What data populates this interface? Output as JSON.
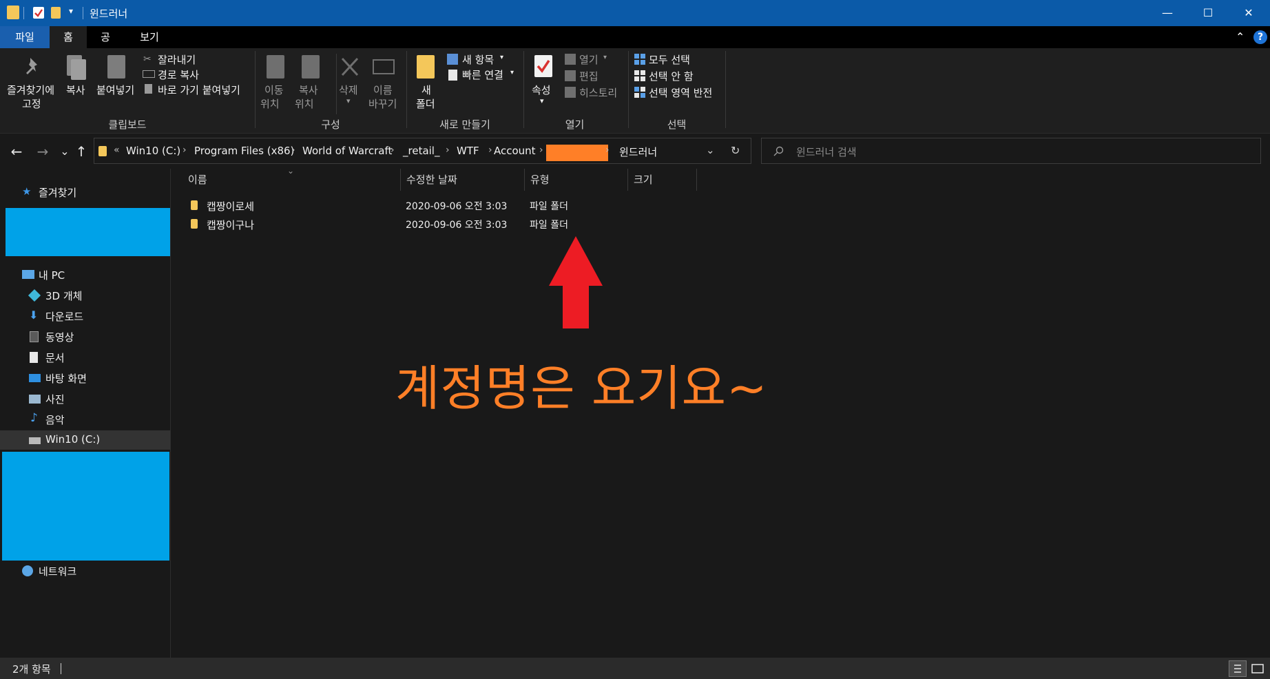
{
  "window": {
    "title": "윈드러너",
    "minimize": "—",
    "maximize": "☐",
    "close": "✕",
    "qat_dropdown": "▾"
  },
  "ribbon_tabs": [
    "파일",
    "홈",
    "공유",
    "보기"
  ],
  "ribbon_help": "?",
  "ribbon_collapse": "⌃",
  "ribbon": {
    "clipboard": {
      "title": "클립보드",
      "pin_line1": "즐겨찾기에",
      "pin_line2": "고정",
      "copy": "복사",
      "paste": "붙여넣기",
      "cut": "잘라내기",
      "copy_path": "경로 복사",
      "paste_shortcut": "바로 가기 붙여넣기"
    },
    "organize": {
      "title": "구성",
      "move_to_1": "이동",
      "move_to_2": "위치",
      "copy_to_1": "복사",
      "copy_to_2": "위치",
      "delete": "삭제",
      "rename_1": "이름",
      "rename_2": "바꾸기"
    },
    "new": {
      "title": "새로 만들기",
      "new_folder_1": "새",
      "new_folder_2": "폴더",
      "new_item": "새 항목",
      "easy_access": "빠른 연결"
    },
    "open": {
      "title": "열기",
      "properties": "속성",
      "open": "열기",
      "edit": "편집",
      "history": "히스토리"
    },
    "select": {
      "title": "선택",
      "select_all": "모두 선택",
      "select_none": "선택 안 함",
      "invert": "선택 영역 반전"
    }
  },
  "address": {
    "overflow": "«",
    "crumbs": [
      "Win10 (C:)",
      "Program Files (x86)",
      "World of Warcraft",
      "_retail_",
      "WTF",
      "Account",
      "",
      "윈드러너"
    ],
    "redacted_color": "#ff7f27",
    "refresh": "↻",
    "dropdown": "⌄"
  },
  "nav": {
    "back": "←",
    "forward": "→",
    "recent": "⌄",
    "up": "↑"
  },
  "search": {
    "placeholder": "윈드러너 검색"
  },
  "sidebar": {
    "favorites": "즐겨찾기",
    "this_pc": "내 PC",
    "items": [
      "3D 개체",
      "다운로드",
      "동영상",
      "문서",
      "바탕 화면",
      "사진",
      "음악",
      "Win10 (C:)"
    ],
    "network": "네트워크",
    "redacted_color": "#00a2e8"
  },
  "columns": {
    "name": "이름",
    "modified": "수정한 날짜",
    "type": "유형",
    "size": "크기"
  },
  "files": [
    {
      "name": "캡짱이로세",
      "modified": "2020-09-06 오전 3:03",
      "type": "파일 폴더",
      "size": ""
    },
    {
      "name": "캡짱이구나",
      "modified": "2020-09-06 오전 3:03",
      "type": "파일 폴더",
      "size": ""
    }
  ],
  "annotation": {
    "text": "계정명은 요기요~",
    "color": "#ff7f27",
    "arrow_color": "#ed1c24"
  },
  "status": {
    "count": "2개 항목"
  }
}
